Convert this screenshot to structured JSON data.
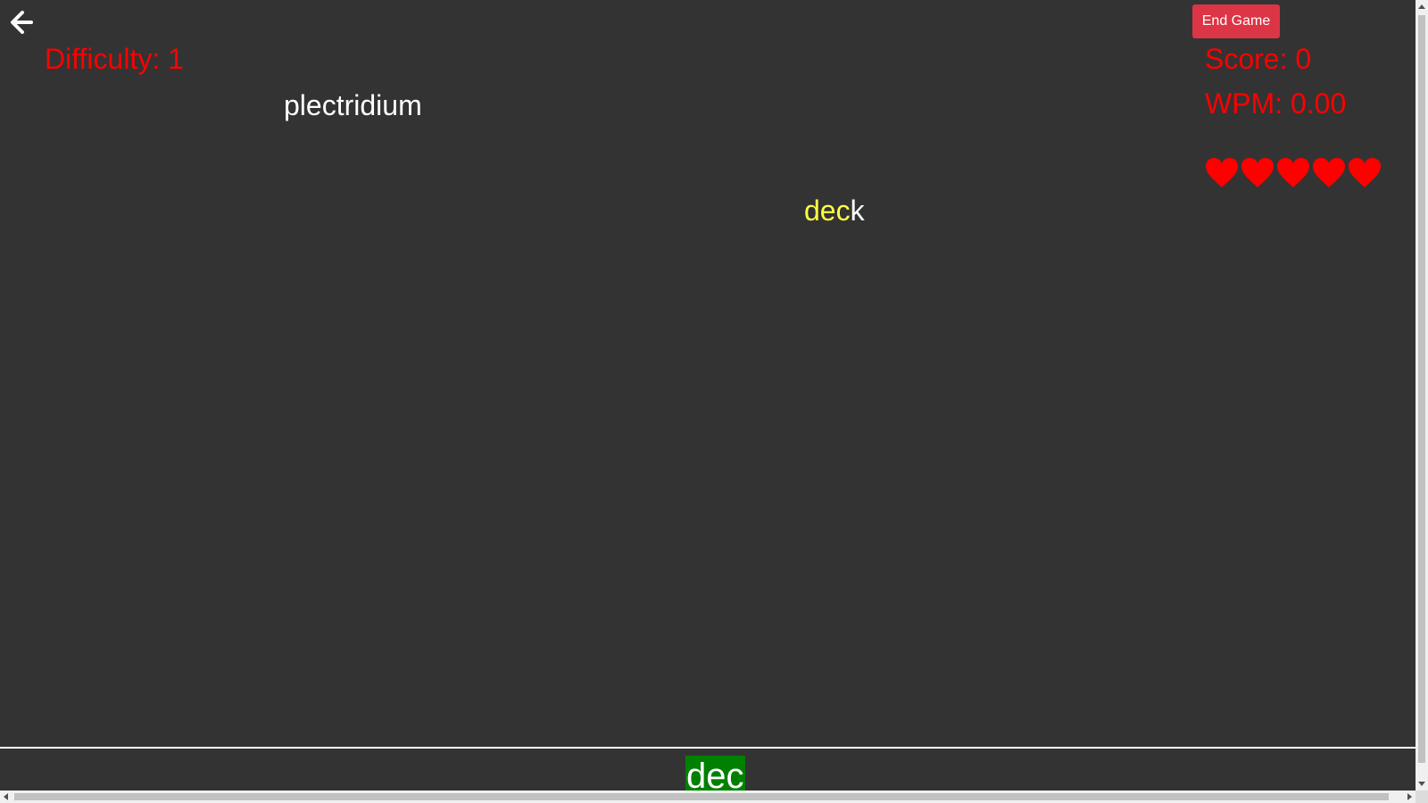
{
  "header": {
    "back_icon": "arrow-left-icon",
    "difficulty_label": "Difficulty: 1",
    "end_game_label": "End Game",
    "score_label": "Score: 0",
    "wpm_label": "WPM: 0.00"
  },
  "lives": {
    "count": 5,
    "icon": "heart-icon",
    "color": "#ff0000"
  },
  "words": [
    {
      "typed": "",
      "remaining": "plectridium"
    },
    {
      "typed": "dec",
      "remaining": "k"
    }
  ],
  "input": {
    "value": "dec"
  },
  "colors": {
    "background": "#333333",
    "stat_text": "#ff0000",
    "word_text": "#ffffff",
    "typed_highlight": "#ffff44",
    "input_background": "#008000",
    "end_game_button": "#dc3545"
  }
}
